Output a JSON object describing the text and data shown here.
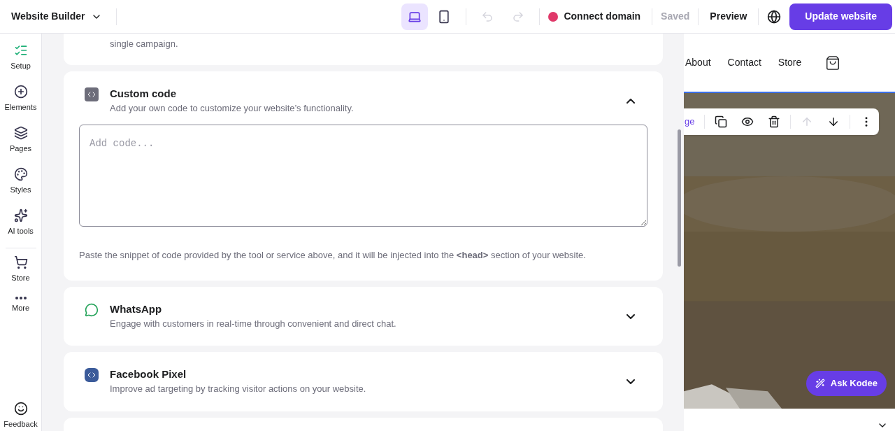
{
  "app_menu": {
    "label": "Website Builder"
  },
  "devices": [
    {
      "kind": "desktop",
      "selected": true
    },
    {
      "kind": "mobile",
      "selected": false
    }
  ],
  "history": [
    {
      "kind": "undo",
      "disabled": true
    },
    {
      "kind": "redo",
      "disabled": true
    }
  ],
  "connect_domain": {
    "label": "Connect domain"
  },
  "save_status": {
    "label": "Saved",
    "disabled": true
  },
  "preview": {
    "label": "Preview"
  },
  "publish": {
    "label": "Update website"
  },
  "sidebar": {
    "items": [
      {
        "kind": "setup",
        "label": "Setup"
      },
      {
        "kind": "elements",
        "label": "Elements"
      },
      {
        "kind": "pages",
        "label": "Pages"
      },
      {
        "kind": "styles",
        "label": "Styles"
      },
      {
        "kind": "ai",
        "label": "AI tools"
      },
      {
        "kind": "store",
        "label": "Store"
      },
      {
        "kind": "more",
        "label": "More"
      }
    ],
    "feedback": {
      "label": "Feedback"
    }
  },
  "top_card": {
    "text": "single campaign."
  },
  "integrations": [
    {
      "kind": "code",
      "title": "Custom code",
      "description": "Add your own code to customize your website’s functionality.",
      "expanded": true,
      "placeholder": "Add code...",
      "note": "Paste the snippet of code provided by the tool or service above, and it will be injected into the **<head>** section of your website."
    },
    {
      "kind": "whatsapp",
      "title": "WhatsApp",
      "description": "Engage with customers in real-time through convenient and direct chat.",
      "expanded": false
    },
    {
      "kind": "pixel",
      "title": "Facebook Pixel",
      "description": "Improve ad targeting by tracking visitor actions on your website.",
      "expanded": false
    }
  ],
  "site_preview": {
    "nav": [
      "About",
      "Contact",
      "Store"
    ],
    "toolbar_fragment": "ge",
    "assistant": "Ask Kodee"
  }
}
